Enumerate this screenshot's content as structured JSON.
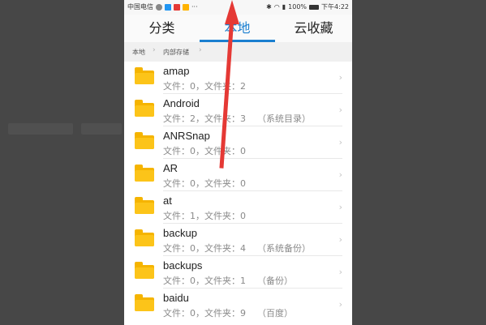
{
  "status_bar": {
    "carrier": "中国电信",
    "battery": "100%",
    "time": "下午4:22"
  },
  "tabs": [
    {
      "label": "分类",
      "active": false
    },
    {
      "label": "本地",
      "active": true
    },
    {
      "label": "云收藏",
      "active": false
    }
  ],
  "breadcrumb": [
    "本地",
    "内部存储"
  ],
  "colors": {
    "accent": "#1a7fd0",
    "folder": "#f5b400",
    "annotation_arrow": "#e53935"
  },
  "files": [
    {
      "name": "amap",
      "meta": "文件：0，文件夹：2"
    },
    {
      "name": "Android",
      "meta": "文件：2，文件夹：3    （系统目录）"
    },
    {
      "name": "ANRSnap",
      "meta": "文件：0，文件夹：0"
    },
    {
      "name": "AR",
      "meta": "文件：0，文件夹：0"
    },
    {
      "name": "at",
      "meta": "文件：1，文件夹：0"
    },
    {
      "name": "backup",
      "meta": "文件：0，文件夹：4    （系统备份）"
    },
    {
      "name": "backups",
      "meta": "文件：0，文件夹：1    （备份）"
    },
    {
      "name": "baidu",
      "meta": "文件：0，文件夹：9    （百度）"
    }
  ]
}
